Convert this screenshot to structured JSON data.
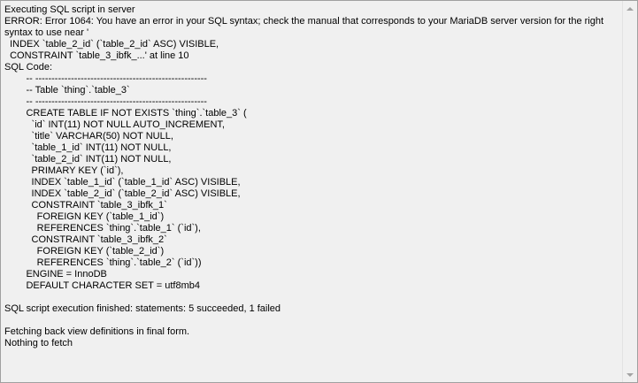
{
  "log": {
    "lines": [
      "Executing SQL script in server",
      "ERROR: Error 1064: You have an error in your SQL syntax; check the manual that corresponds to your MariaDB server version for the right",
      "syntax to use near '",
      "  INDEX `table_2_id` (`table_2_id` ASC) VISIBLE,",
      "  CONSTRAINT `table_3_ibfk_...' at line 10",
      "SQL Code:",
      "        -- -----------------------------------------------------",
      "        -- Table `thing`.`table_3`",
      "        -- -----------------------------------------------------",
      "        CREATE TABLE IF NOT EXISTS `thing`.`table_3` (",
      "          `id` INT(11) NOT NULL AUTO_INCREMENT,",
      "          `title` VARCHAR(50) NOT NULL,",
      "          `table_1_id` INT(11) NOT NULL,",
      "          `table_2_id` INT(11) NOT NULL,",
      "          PRIMARY KEY (`id`),",
      "          INDEX `table_1_id` (`table_1_id` ASC) VISIBLE,",
      "          INDEX `table_2_id` (`table_2_id` ASC) VISIBLE,",
      "          CONSTRAINT `table_3_ibfk_1`",
      "            FOREIGN KEY (`table_1_id`)",
      "            REFERENCES `thing`.`table_1` (`id`),",
      "          CONSTRAINT `table_3_ibfk_2`",
      "            FOREIGN KEY (`table_2_id`)",
      "            REFERENCES `thing`.`table_2` (`id`))",
      "        ENGINE = InnoDB",
      "        DEFAULT CHARACTER SET = utf8mb4",
      "",
      "SQL script execution finished: statements: 5 succeeded, 1 failed",
      "",
      "Fetching back view definitions in final form.",
      "Nothing to fetch"
    ]
  },
  "icons": {
    "scroll_up": "triangle-up-icon",
    "scroll_down": "triangle-down-icon"
  }
}
